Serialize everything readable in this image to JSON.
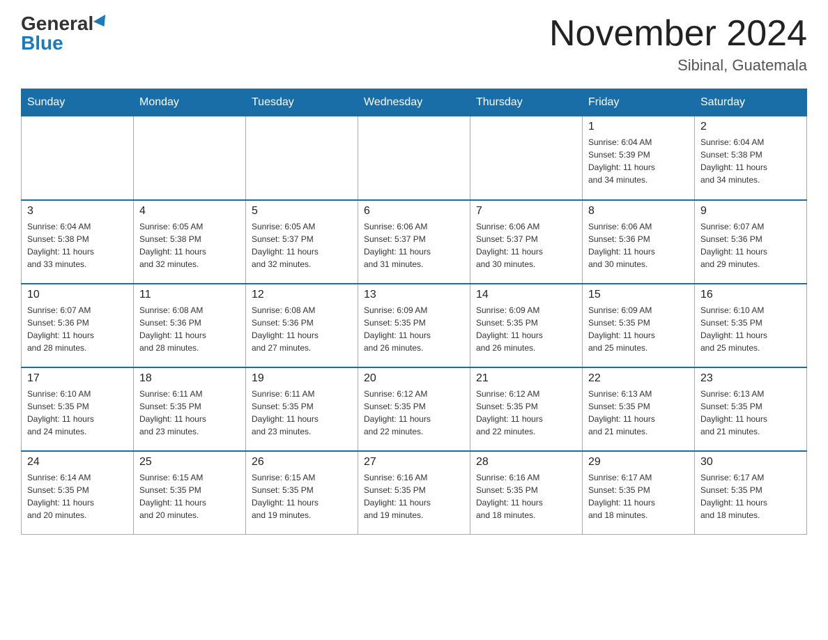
{
  "header": {
    "logo_general": "General",
    "logo_blue": "Blue",
    "month_title": "November 2024",
    "location": "Sibinal, Guatemala"
  },
  "calendar": {
    "days_of_week": [
      "Sunday",
      "Monday",
      "Tuesday",
      "Wednesday",
      "Thursday",
      "Friday",
      "Saturday"
    ],
    "weeks": [
      [
        {
          "day": "",
          "info": ""
        },
        {
          "day": "",
          "info": ""
        },
        {
          "day": "",
          "info": ""
        },
        {
          "day": "",
          "info": ""
        },
        {
          "day": "",
          "info": ""
        },
        {
          "day": "1",
          "info": "Sunrise: 6:04 AM\nSunset: 5:39 PM\nDaylight: 11 hours\nand 34 minutes."
        },
        {
          "day": "2",
          "info": "Sunrise: 6:04 AM\nSunset: 5:38 PM\nDaylight: 11 hours\nand 34 minutes."
        }
      ],
      [
        {
          "day": "3",
          "info": "Sunrise: 6:04 AM\nSunset: 5:38 PM\nDaylight: 11 hours\nand 33 minutes."
        },
        {
          "day": "4",
          "info": "Sunrise: 6:05 AM\nSunset: 5:38 PM\nDaylight: 11 hours\nand 32 minutes."
        },
        {
          "day": "5",
          "info": "Sunrise: 6:05 AM\nSunset: 5:37 PM\nDaylight: 11 hours\nand 32 minutes."
        },
        {
          "day": "6",
          "info": "Sunrise: 6:06 AM\nSunset: 5:37 PM\nDaylight: 11 hours\nand 31 minutes."
        },
        {
          "day": "7",
          "info": "Sunrise: 6:06 AM\nSunset: 5:37 PM\nDaylight: 11 hours\nand 30 minutes."
        },
        {
          "day": "8",
          "info": "Sunrise: 6:06 AM\nSunset: 5:36 PM\nDaylight: 11 hours\nand 30 minutes."
        },
        {
          "day": "9",
          "info": "Sunrise: 6:07 AM\nSunset: 5:36 PM\nDaylight: 11 hours\nand 29 minutes."
        }
      ],
      [
        {
          "day": "10",
          "info": "Sunrise: 6:07 AM\nSunset: 5:36 PM\nDaylight: 11 hours\nand 28 minutes."
        },
        {
          "day": "11",
          "info": "Sunrise: 6:08 AM\nSunset: 5:36 PM\nDaylight: 11 hours\nand 28 minutes."
        },
        {
          "day": "12",
          "info": "Sunrise: 6:08 AM\nSunset: 5:36 PM\nDaylight: 11 hours\nand 27 minutes."
        },
        {
          "day": "13",
          "info": "Sunrise: 6:09 AM\nSunset: 5:35 PM\nDaylight: 11 hours\nand 26 minutes."
        },
        {
          "day": "14",
          "info": "Sunrise: 6:09 AM\nSunset: 5:35 PM\nDaylight: 11 hours\nand 26 minutes."
        },
        {
          "day": "15",
          "info": "Sunrise: 6:09 AM\nSunset: 5:35 PM\nDaylight: 11 hours\nand 25 minutes."
        },
        {
          "day": "16",
          "info": "Sunrise: 6:10 AM\nSunset: 5:35 PM\nDaylight: 11 hours\nand 25 minutes."
        }
      ],
      [
        {
          "day": "17",
          "info": "Sunrise: 6:10 AM\nSunset: 5:35 PM\nDaylight: 11 hours\nand 24 minutes."
        },
        {
          "day": "18",
          "info": "Sunrise: 6:11 AM\nSunset: 5:35 PM\nDaylight: 11 hours\nand 23 minutes."
        },
        {
          "day": "19",
          "info": "Sunrise: 6:11 AM\nSunset: 5:35 PM\nDaylight: 11 hours\nand 23 minutes."
        },
        {
          "day": "20",
          "info": "Sunrise: 6:12 AM\nSunset: 5:35 PM\nDaylight: 11 hours\nand 22 minutes."
        },
        {
          "day": "21",
          "info": "Sunrise: 6:12 AM\nSunset: 5:35 PM\nDaylight: 11 hours\nand 22 minutes."
        },
        {
          "day": "22",
          "info": "Sunrise: 6:13 AM\nSunset: 5:35 PM\nDaylight: 11 hours\nand 21 minutes."
        },
        {
          "day": "23",
          "info": "Sunrise: 6:13 AM\nSunset: 5:35 PM\nDaylight: 11 hours\nand 21 minutes."
        }
      ],
      [
        {
          "day": "24",
          "info": "Sunrise: 6:14 AM\nSunset: 5:35 PM\nDaylight: 11 hours\nand 20 minutes."
        },
        {
          "day": "25",
          "info": "Sunrise: 6:15 AM\nSunset: 5:35 PM\nDaylight: 11 hours\nand 20 minutes."
        },
        {
          "day": "26",
          "info": "Sunrise: 6:15 AM\nSunset: 5:35 PM\nDaylight: 11 hours\nand 19 minutes."
        },
        {
          "day": "27",
          "info": "Sunrise: 6:16 AM\nSunset: 5:35 PM\nDaylight: 11 hours\nand 19 minutes."
        },
        {
          "day": "28",
          "info": "Sunrise: 6:16 AM\nSunset: 5:35 PM\nDaylight: 11 hours\nand 18 minutes."
        },
        {
          "day": "29",
          "info": "Sunrise: 6:17 AM\nSunset: 5:35 PM\nDaylight: 11 hours\nand 18 minutes."
        },
        {
          "day": "30",
          "info": "Sunrise: 6:17 AM\nSunset: 5:35 PM\nDaylight: 11 hours\nand 18 minutes."
        }
      ]
    ]
  }
}
